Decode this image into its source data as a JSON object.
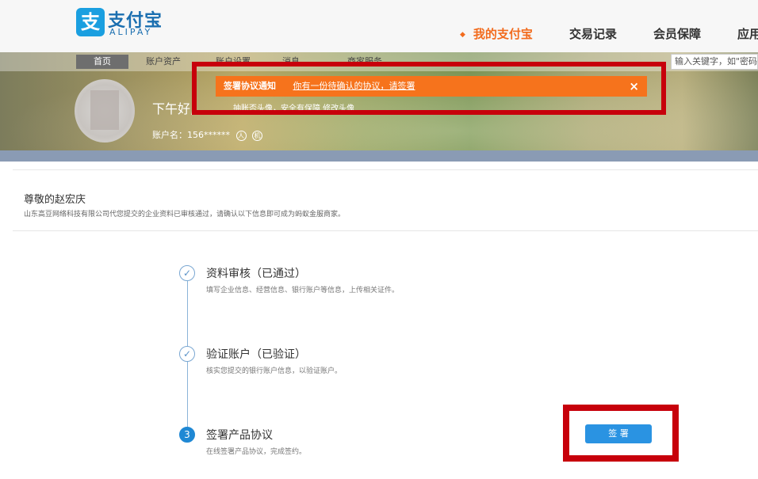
{
  "header": {
    "logo_mark": "支",
    "logo_cn": "支付宝",
    "logo_en": "ALIPAY",
    "nav": [
      "我的支付宝",
      "交易记录",
      "会员保障",
      "应用"
    ]
  },
  "subnav": {
    "home": "首页",
    "assets": "账户资产",
    "settings": "账户设置",
    "messages": "消息",
    "services": "商家服务",
    "search_value": "输入关键字，如\"密码\""
  },
  "user": {
    "greeting": "下午好,",
    "account_label": "账户名：156******",
    "icon1": "人",
    "icon2": "机"
  },
  "notice": {
    "title": "签署协议通知",
    "text": "你有一份待确认的协议，请签署",
    "close": "×",
    "sub": "抽账否头像，安全有保障 修改头像"
  },
  "content": {
    "hello": "尊敬的赵宏庆",
    "company": "山东高豆网络科技有限公司代您提交的企业资料已审核通过，请确认以下信息即可成为蚂蚁金服商家。"
  },
  "steps": [
    {
      "icon": "✓",
      "title": "资料审核（已通过）",
      "desc": "填写企业信息、经营信息、银行账户等信息，上传相关证件。"
    },
    {
      "icon": "✓",
      "title": "验证账户（已验证）",
      "desc": "核实您提交的银行账户信息，以验证账户。"
    },
    {
      "icon": "3",
      "title": "签署产品协议",
      "desc": "在线签署产品协议，完成签约。"
    }
  ],
  "sign_button": "签 署",
  "colors": {
    "accent": "#f26b1d",
    "brand": "#1a9fe0",
    "highlight": "#c7000b",
    "button": "#2a93e2"
  }
}
